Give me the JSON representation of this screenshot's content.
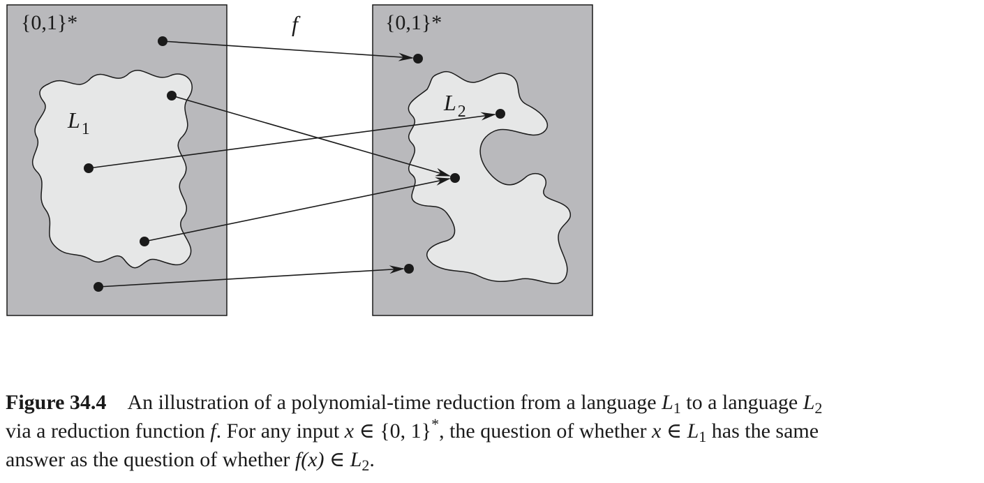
{
  "figure": {
    "left_panel_label": "{0,1}*",
    "right_panel_label": "{0,1}*",
    "function_label": "f",
    "language1_label": "L",
    "language1_subscript": "1",
    "language2_label": "L",
    "language2_subscript": "2",
    "colors": {
      "panel_fill": "#b9b9bc",
      "language_fill": "#e6e7e7",
      "ink": "#1a1a1a"
    }
  },
  "caption": {
    "figure_number": "Figure 34.4",
    "line1_text": "An illustration of a polynomial-time reduction from a language",
    "line1_l1": "L",
    "line1_l1_sub": "1",
    "line1_mid": "to a language",
    "line1_l2": "L",
    "line1_l2_sub": "2",
    "line2_start": "via a reduction function",
    "line2_f": "f",
    "line2_mid": ". For any input",
    "line2_x": "x",
    "line2_in": "∈ {0, 1}",
    "line2_star": "*",
    "line2_q": ", the question of whether",
    "line2_x2": "x",
    "line2_in2": "∈",
    "line2_l1": "L",
    "line2_l1_sub": "1",
    "line2_end": "has the same",
    "line3_start": "answer as the question of whether",
    "line3_f": "f",
    "line3_arg": "(x)",
    "line3_in": "∈",
    "line3_l2": "L",
    "line3_l2_sub": "2",
    "line3_end": "."
  }
}
